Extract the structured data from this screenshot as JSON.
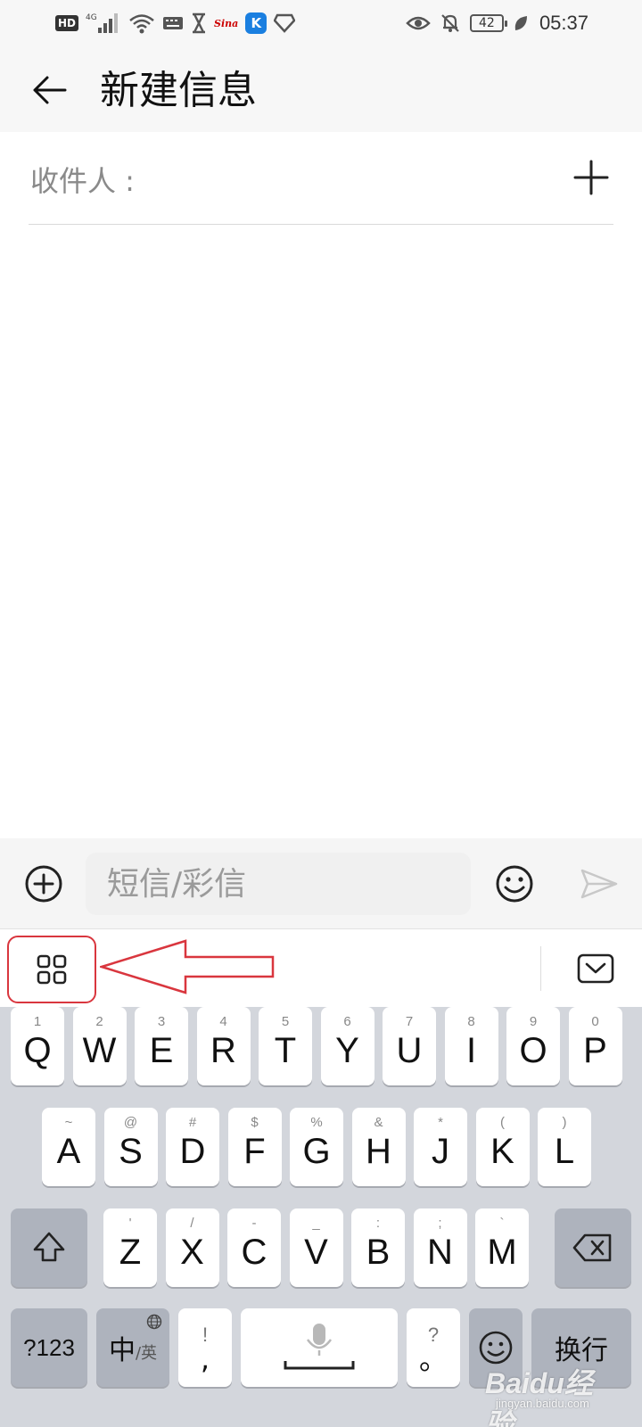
{
  "status_bar": {
    "network_badge": "HD",
    "network_type": "4G",
    "carrier_app": "Sina",
    "k_app": "K",
    "battery_level": "42",
    "time": "05:37",
    "icons": [
      "hd-icon",
      "signal-icon",
      "wifi-icon",
      "keyboard-icon",
      "hourglass-icon",
      "sina-icon",
      "k-app-icon",
      "diamond-icon",
      "eye-icon",
      "bell-off-icon",
      "battery-icon",
      "leaf-icon"
    ]
  },
  "header": {
    "title": "新建信息",
    "back_icon": "back-arrow-icon"
  },
  "recipient": {
    "label": "收件人 :",
    "add_icon": "plus-icon"
  },
  "compose": {
    "placeholder": "短信/彩信",
    "attach_icon": "circle-plus-icon",
    "emoji_icon": "smiley-icon",
    "send_icon": "send-icon"
  },
  "keyboard_toolbar": {
    "menu_icon": "grid-icon",
    "hide_icon": "keyboard-hide-icon",
    "annotation": "red-arrow-annotation"
  },
  "keyboard": {
    "row1": [
      {
        "key": "Q",
        "hint": "1"
      },
      {
        "key": "W",
        "hint": "2"
      },
      {
        "key": "E",
        "hint": "3"
      },
      {
        "key": "R",
        "hint": "4"
      },
      {
        "key": "T",
        "hint": "5"
      },
      {
        "key": "Y",
        "hint": "6"
      },
      {
        "key": "U",
        "hint": "7"
      },
      {
        "key": "I",
        "hint": "8"
      },
      {
        "key": "O",
        "hint": "9"
      },
      {
        "key": "P",
        "hint": "0"
      }
    ],
    "row2": [
      {
        "key": "A",
        "hint": "~"
      },
      {
        "key": "S",
        "hint": "@"
      },
      {
        "key": "D",
        "hint": "#"
      },
      {
        "key": "F",
        "hint": "$"
      },
      {
        "key": "G",
        "hint": "%"
      },
      {
        "key": "H",
        "hint": "&"
      },
      {
        "key": "J",
        "hint": "*"
      },
      {
        "key": "K",
        "hint": "("
      },
      {
        "key": "L",
        "hint": ")"
      }
    ],
    "row3": [
      {
        "key": "Z",
        "hint": "'"
      },
      {
        "key": "X",
        "hint": "/"
      },
      {
        "key": "C",
        "hint": "-"
      },
      {
        "key": "V",
        "hint": "_"
      },
      {
        "key": "B",
        "hint": ":"
      },
      {
        "key": "N",
        "hint": ";"
      },
      {
        "key": "M",
        "hint": "`"
      }
    ],
    "symbols_label": "?123",
    "lang_main": "中",
    "lang_alt": "/英",
    "comma_top": "!",
    "comma_bottom": ",",
    "period_top": "?",
    "period_bottom": "。",
    "enter_label": "换行"
  },
  "watermark": {
    "text": "Baidu经验",
    "sub": "jingyan.baidu.com"
  },
  "colors": {
    "annotation_red": "#d9363e",
    "keyboard_bg": "#d3d6dc",
    "dark_key": "#aeb3bd"
  }
}
